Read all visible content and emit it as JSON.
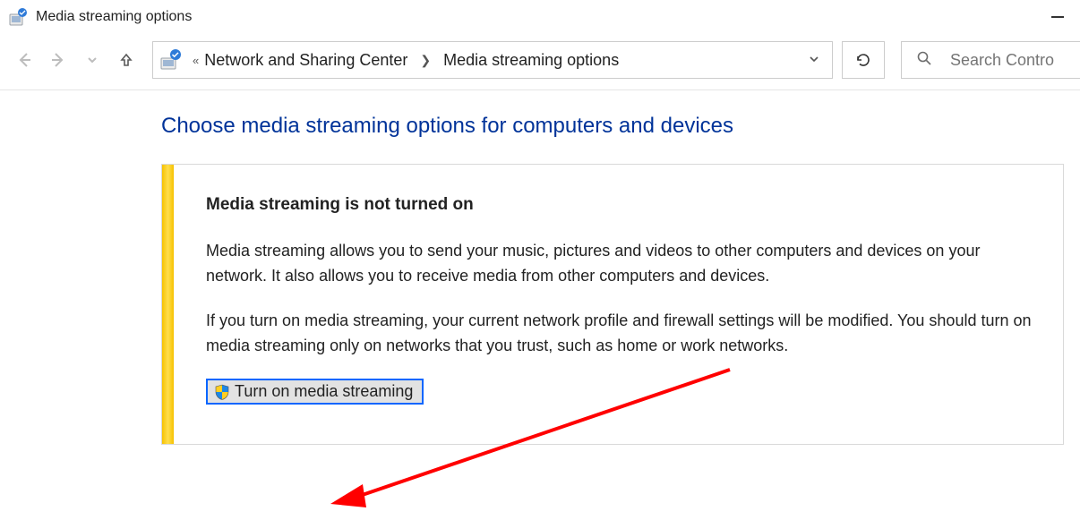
{
  "window": {
    "title": "Media streaming options"
  },
  "breadcrumb": {
    "parent": "Network and Sharing Center",
    "current": "Media streaming options"
  },
  "search": {
    "placeholder": "Search Contro"
  },
  "page": {
    "heading": "Choose media streaming options for computers and devices",
    "panel": {
      "subhead": "Media streaming is not turned on",
      "para1": "Media streaming allows you to send your music, pictures and videos to other computers and devices on your network.  It also allows you to receive media from other computers and devices.",
      "para2": "If you turn on media streaming, your current network profile and firewall settings will be modified.  You should turn on media streaming only on networks that you trust, such as home or work networks.",
      "button_label": "Turn on media streaming"
    }
  }
}
